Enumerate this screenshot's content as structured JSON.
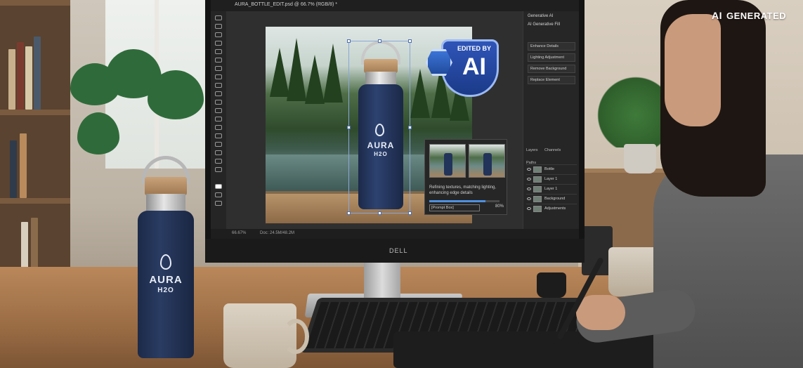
{
  "watermark": {
    "ai_mark": "AI",
    "label": "GENERATED"
  },
  "bottle": {
    "brand_top": "AURA",
    "brand_bottom": "H2O"
  },
  "monitor": {
    "brand": "DELL"
  },
  "photoshop": {
    "doc_tab": "AURA_BOTTLE_EDIT.psd @ 66.7% (RGB/8) *",
    "ai_panel_title": "Generative AI",
    "ai_panel_sub": "AI Generative Fill",
    "ai_items": [
      "Enhance Details",
      "Lighting Adjustment",
      "Remove Background",
      "Replace Element"
    ],
    "layer_tabs": [
      "Layers",
      "Channels",
      "Paths"
    ],
    "layers": [
      "Bottle",
      "Layer 1",
      "Layer 1",
      "Background",
      "Adjustments"
    ],
    "popup_message": "Refining textures, matching lighting, enhancing edge details",
    "prompt_placeholder": "[Prompt Box]",
    "progress_percent": "80%",
    "progress_value": 0.8,
    "status_left": "66.67%",
    "status_mid": "Doc: 24.5M/48.2M"
  },
  "badge": {
    "edited_by": "EDITED BY",
    "ai": "AI"
  },
  "colors": {
    "bottle_navy": "#1f2d4f",
    "badge_blue": "#2448a0",
    "accent_progress": "#4f8fe0"
  }
}
